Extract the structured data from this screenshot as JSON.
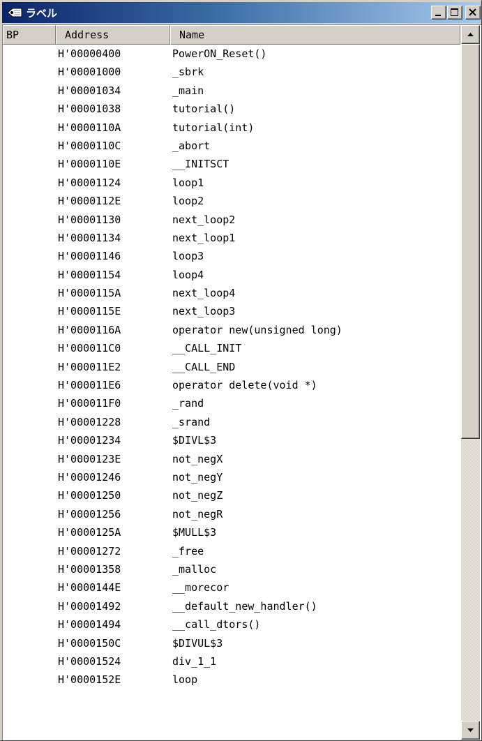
{
  "window": {
    "title": "ラベル",
    "icon": "label-window-icon"
  },
  "columns": {
    "bp": "BP",
    "address": "Address",
    "name": "Name"
  },
  "rows": [
    {
      "bp": "",
      "address": "H'00000400",
      "name": "PowerON_Reset()"
    },
    {
      "bp": "",
      "address": "H'00001000",
      "name": "_sbrk"
    },
    {
      "bp": "",
      "address": "H'00001034",
      "name": "_main"
    },
    {
      "bp": "",
      "address": "H'00001038",
      "name": "tutorial()"
    },
    {
      "bp": "",
      "address": "H'0000110A",
      "name": "tutorial(int)"
    },
    {
      "bp": "",
      "address": "H'0000110C",
      "name": "_abort"
    },
    {
      "bp": "",
      "address": "H'0000110E",
      "name": "__INITSCT"
    },
    {
      "bp": "",
      "address": "H'00001124",
      "name": "loop1"
    },
    {
      "bp": "",
      "address": "H'0000112E",
      "name": "loop2"
    },
    {
      "bp": "",
      "address": "H'00001130",
      "name": "next_loop2"
    },
    {
      "bp": "",
      "address": "H'00001134",
      "name": "next_loop1"
    },
    {
      "bp": "",
      "address": "H'00001146",
      "name": "loop3"
    },
    {
      "bp": "",
      "address": "H'00001154",
      "name": "loop4"
    },
    {
      "bp": "",
      "address": "H'0000115A",
      "name": "next_loop4"
    },
    {
      "bp": "",
      "address": "H'0000115E",
      "name": "next_loop3"
    },
    {
      "bp": "",
      "address": "H'0000116A",
      "name": "operator new(unsigned long)"
    },
    {
      "bp": "",
      "address": "H'000011C0",
      "name": "__CALL_INIT"
    },
    {
      "bp": "",
      "address": "H'000011E2",
      "name": "__CALL_END"
    },
    {
      "bp": "",
      "address": "H'000011E6",
      "name": "operator delete(void *)"
    },
    {
      "bp": "",
      "address": "H'000011F0",
      "name": "_rand"
    },
    {
      "bp": "",
      "address": "H'00001228",
      "name": "_srand"
    },
    {
      "bp": "",
      "address": "H'00001234",
      "name": "$DIVL$3"
    },
    {
      "bp": "",
      "address": "H'0000123E",
      "name": "not_negX"
    },
    {
      "bp": "",
      "address": "H'00001246",
      "name": "not_negY"
    },
    {
      "bp": "",
      "address": "H'00001250",
      "name": "not_negZ"
    },
    {
      "bp": "",
      "address": "H'00001256",
      "name": "not_negR"
    },
    {
      "bp": "",
      "address": "H'0000125A",
      "name": "$MULL$3"
    },
    {
      "bp": "",
      "address": "H'00001272",
      "name": "_free"
    },
    {
      "bp": "",
      "address": "H'00001358",
      "name": "_malloc"
    },
    {
      "bp": "",
      "address": "H'0000144E",
      "name": "__morecor"
    },
    {
      "bp": "",
      "address": "H'00001492",
      "name": "__default_new_handler()"
    },
    {
      "bp": "",
      "address": "H'00001494",
      "name": "__call_dtors()"
    },
    {
      "bp": "",
      "address": "H'0000150C",
      "name": "$DIVUL$3"
    },
    {
      "bp": "",
      "address": "H'00001524",
      "name": "div_1_1"
    },
    {
      "bp": "",
      "address": "H'0000152E",
      "name": "loop"
    }
  ],
  "colors": {
    "title_gradient_start": "#0a246a",
    "title_gradient_end": "#a6caf0",
    "face": "#d4d0c8"
  }
}
